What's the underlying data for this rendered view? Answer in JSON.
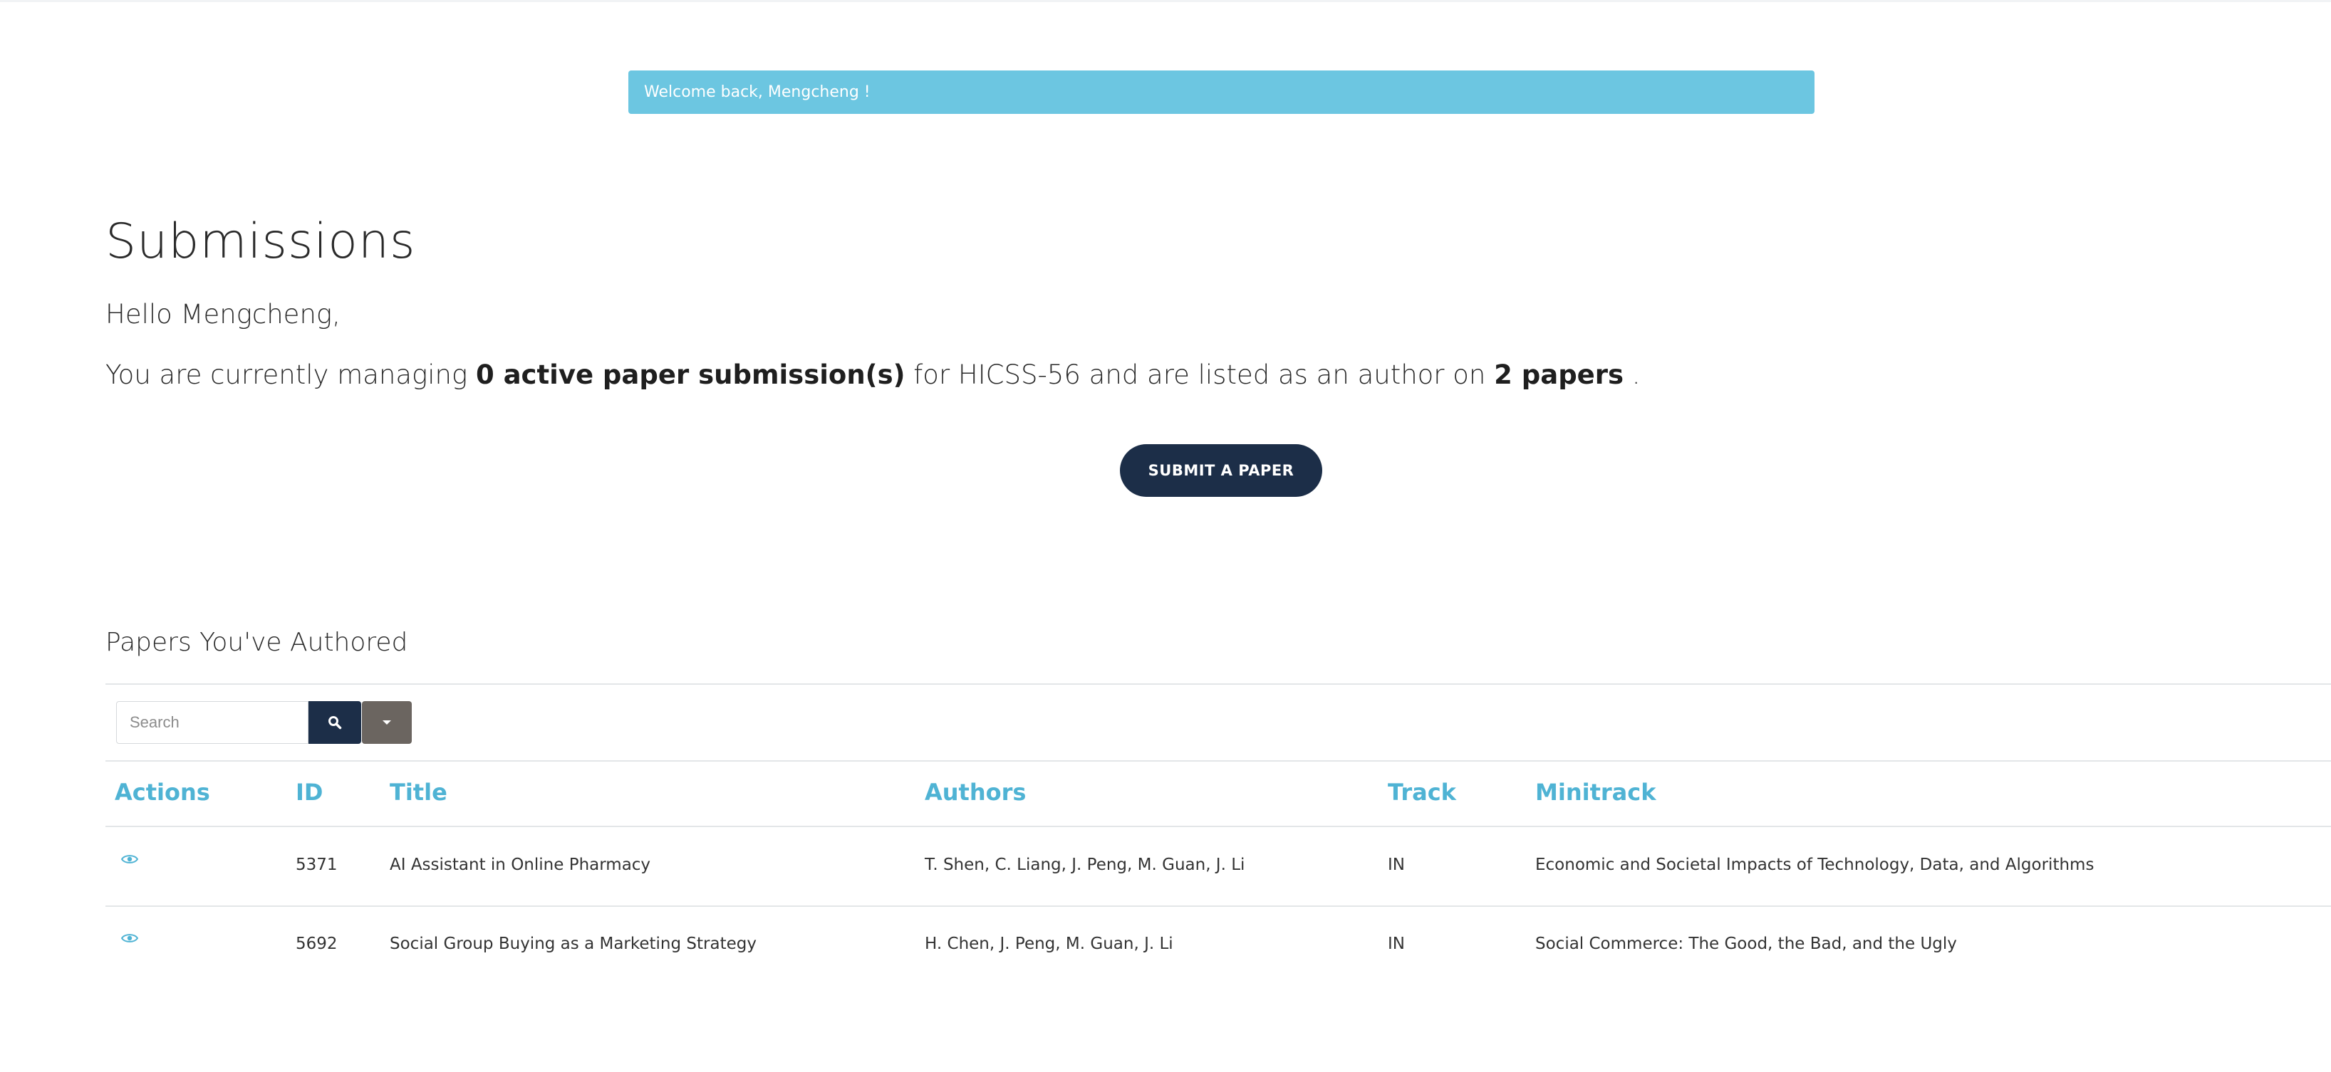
{
  "alert": {
    "text": "Welcome back, Mengcheng !"
  },
  "page": {
    "title": "Submissions",
    "greeting": "Hello Mengcheng,",
    "summary": {
      "prefix": "You are currently managing ",
      "active_count": "0 active paper submission(s)",
      "middle": " for HICSS-56 and are listed as an author on ",
      "papers_count": "2 papers",
      "suffix": " ."
    },
    "submit_button": "SUBMIT A PAPER"
  },
  "authored": {
    "section_title": "Papers You've Authored",
    "search_placeholder": "Search",
    "columns": {
      "actions": "Actions",
      "id": "ID",
      "title": "Title",
      "authors": "Authors",
      "track": "Track",
      "minitrack": "Minitrack"
    },
    "rows": [
      {
        "action_icon": "eye-icon",
        "id": "5371",
        "title": "AI Assistant in Online Pharmacy",
        "authors": "T. Shen, C. Liang, J. Peng, M. Guan, J. Li",
        "track": "IN",
        "minitrack": "Economic and Societal Impacts of Technology, Data, and Algorithms"
      },
      {
        "action_icon": "eye-icon",
        "id": "5692",
        "title": "Social Group Buying as a Marketing Strategy",
        "authors": "H. Chen, J. Peng, M. Guan, J. Li",
        "track": "IN",
        "minitrack": "Social Commerce: The Good, the Bad, and the Ugly"
      }
    ]
  },
  "colors": {
    "alert_bg": "#6cc6e1",
    "primary_navy": "#1c2e48",
    "dropdown_gray": "#6b6560",
    "header_blue": "#4fb3d4"
  }
}
